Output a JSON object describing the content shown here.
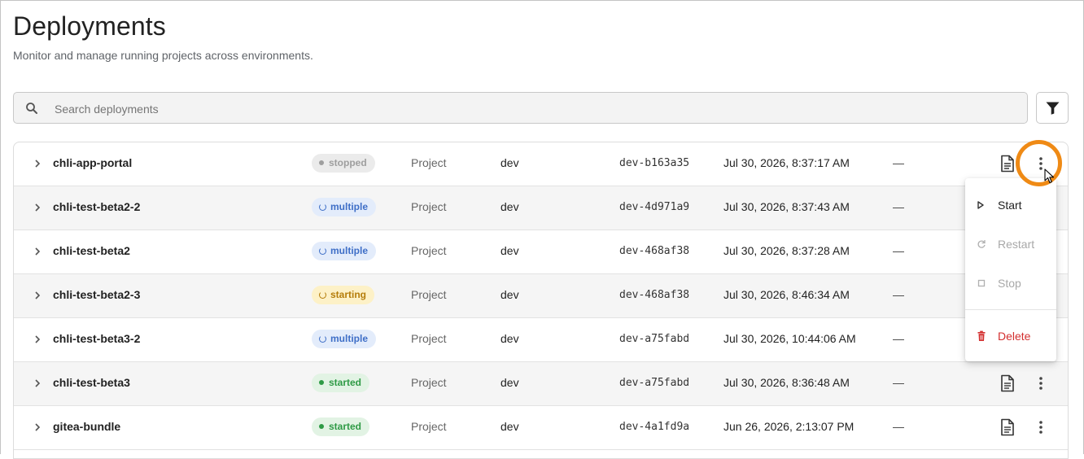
{
  "header": {
    "title": "Deployments",
    "subtitle": "Monitor and manage running projects across environments."
  },
  "search": {
    "placeholder": "Search deployments",
    "icon": "search-icon"
  },
  "filter": {
    "icon": "filter-icon"
  },
  "colors": {
    "stopped": "#9e9e9e",
    "multiple": "#3f6fc7",
    "starting": "#b57d0a",
    "started": "#2e9a45",
    "delete": "#d32f2f",
    "highlight": "#ef8a15"
  },
  "rows": [
    {
      "name": "chli-app-portal",
      "status": "stopped",
      "type": "Project",
      "env": "dev",
      "hash": "dev-b163a35",
      "date": "Jul 30, 2026, 8:37:17 AM",
      "extra": "—"
    },
    {
      "name": "chli-test-beta2-2",
      "status": "multiple",
      "type": "Project",
      "env": "dev",
      "hash": "dev-4d971a9",
      "date": "Jul 30, 2026, 8:37:43 AM",
      "extra": "—"
    },
    {
      "name": "chli-test-beta2",
      "status": "multiple",
      "type": "Project",
      "env": "dev",
      "hash": "dev-468af38",
      "date": "Jul 30, 2026, 8:37:28 AM",
      "extra": "—"
    },
    {
      "name": "chli-test-beta2-3",
      "status": "starting",
      "type": "Project",
      "env": "dev",
      "hash": "dev-468af38",
      "date": "Jul 30, 2026, 8:46:34 AM",
      "extra": "—"
    },
    {
      "name": "chli-test-beta3-2",
      "status": "multiple",
      "type": "Project",
      "env": "dev",
      "hash": "dev-a75fabd",
      "date": "Jul 30, 2026, 10:44:06 AM",
      "extra": "—"
    },
    {
      "name": "chli-test-beta3",
      "status": "started",
      "type": "Project",
      "env": "dev",
      "hash": "dev-a75fabd",
      "date": "Jul 30, 2026, 8:36:48 AM",
      "extra": "—"
    },
    {
      "name": "gitea-bundle",
      "status": "started",
      "type": "Project",
      "env": "dev",
      "hash": "dev-4a1fd9a",
      "date": "Jun 26, 2026, 2:13:07 PM",
      "extra": "—"
    }
  ],
  "menu": {
    "start": "Start",
    "restart": "Restart",
    "stop": "Stop",
    "delete": "Delete"
  }
}
